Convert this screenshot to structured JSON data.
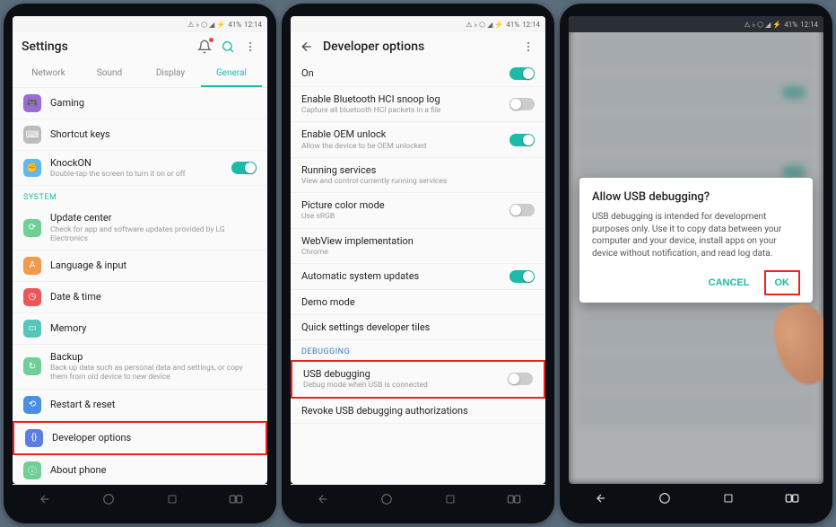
{
  "status": {
    "time": "12:14",
    "battery": "41%",
    "signal": "▲"
  },
  "phone1": {
    "header": "Settings",
    "tabs": [
      "Network",
      "Sound",
      "Display",
      "General"
    ],
    "active_tab": 3,
    "rows": [
      {
        "icon_bg": "#9b6bd6",
        "icon": "🎮",
        "title": "Gaming"
      },
      {
        "icon_bg": "#bcbcbc",
        "icon": "⌨",
        "title": "Shortcut keys"
      },
      {
        "icon_bg": "#5db8f0",
        "icon": "✊",
        "title": "KnockON",
        "sub": "Double-tap the screen to turn it on or off",
        "toggle": true,
        "on": true
      }
    ],
    "section": "SYSTEM",
    "rows2": [
      {
        "icon_bg": "#6fcf97",
        "icon": "⟳",
        "title": "Update center",
        "sub": "Check for app and software updates provided by LG Electronics"
      },
      {
        "icon_bg": "#f2994a",
        "icon": "A",
        "title": "Language & input"
      },
      {
        "icon_bg": "#eb5757",
        "icon": "◷",
        "title": "Date & time"
      },
      {
        "icon_bg": "#56c6b8",
        "icon": "▭",
        "title": "Memory"
      },
      {
        "icon_bg": "#6fcf97",
        "icon": "↻",
        "title": "Backup",
        "sub": "Back up data such as personal data and settings, or copy them from old device to new device"
      },
      {
        "icon_bg": "#4a90e2",
        "icon": "⟲",
        "title": "Restart & reset"
      },
      {
        "icon_bg": "#5b7ee0",
        "icon": "{}",
        "title": "Developer options",
        "hl": true
      },
      {
        "icon_bg": "#6fcf97",
        "icon": "ⓘ",
        "title": "About phone"
      }
    ]
  },
  "phone2": {
    "header": "Developer options",
    "rows": [
      {
        "title": "On",
        "toggle": true,
        "on": true
      },
      {
        "title": "Enable Bluetooth HCI snoop log",
        "sub": "Capture all bluetooth HCI packets in a file",
        "toggle": true,
        "on": false
      },
      {
        "title": "Enable OEM unlock",
        "sub": "Allow the device to be OEM unlocked",
        "toggle": true,
        "on": true
      },
      {
        "title": "Running services",
        "sub": "View and control currently running services"
      },
      {
        "title": "Picture color mode",
        "sub": "Use sRGB",
        "toggle": true,
        "on": false
      },
      {
        "title": "WebView implementation",
        "sub": "Chrome"
      },
      {
        "title": "Automatic system updates",
        "toggle": true,
        "on": true
      },
      {
        "title": "Demo mode"
      },
      {
        "title": "Quick settings developer tiles"
      }
    ],
    "section": "DEBUGGING",
    "rows2": [
      {
        "title": "USB debugging",
        "sub": "Debug mode when USB is connected",
        "toggle": true,
        "on": false,
        "hl": true
      },
      {
        "title": "Revoke USB debugging authorizations"
      }
    ]
  },
  "phone3": {
    "dialog_title": "Allow USB debugging?",
    "dialog_body": "USB debugging is intended for development purposes only. Use it to copy data between your computer and your device, install apps on your device without notification, and read log data.",
    "cancel": "CANCEL",
    "ok": "OK"
  }
}
